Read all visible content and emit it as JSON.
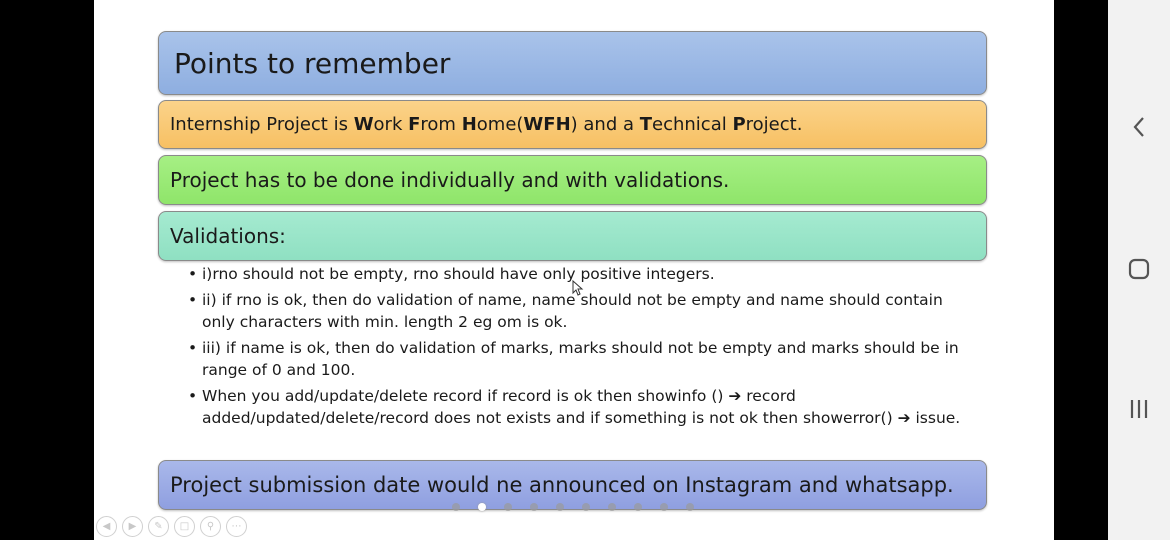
{
  "slide": {
    "title": "Points to remember",
    "wfh_line": {
      "parts": [
        {
          "t": "Internship Project is ",
          "b": false
        },
        {
          "t": "W",
          "b": true
        },
        {
          "t": "ork ",
          "b": false
        },
        {
          "t": "F",
          "b": true
        },
        {
          "t": "rom ",
          "b": false
        },
        {
          "t": "H",
          "b": true
        },
        {
          "t": "ome(",
          "b": false
        },
        {
          "t": "WFH",
          "b": true
        },
        {
          "t": ") and a ",
          "b": false
        },
        {
          "t": "T",
          "b": true
        },
        {
          "t": "echnical ",
          "b": false
        },
        {
          "t": "P",
          "b": true
        },
        {
          "t": "roject.",
          "b": false
        }
      ]
    },
    "individual_line": "Project has to be done individually and with validations.",
    "validations_header": "Validations:",
    "bullets": [
      "i)rno should not be empty, rno should have only positive integers.",
      "ii) if rno is ok, then do validation of name, name should not be empty and name should contain only characters with min. length 2 eg om is ok.",
      "iii) if name is ok, then do validation of marks, marks should not be empty and marks should be in range of 0 and 100.",
      "When you add/update/delete record if record is ok then showinfo () ➔ record added/updated/delete/record does not exists and if something is not ok then showerror() ➔ issue."
    ],
    "submission_line": "Project submission date would ne announced on Instagram and whatsapp."
  },
  "pagination": {
    "total": 10,
    "active_index": 1
  },
  "slide_controls": [
    "prev-icon",
    "next-icon",
    "pen-icon",
    "slides-icon",
    "zoom-icon",
    "more-icon"
  ],
  "android_nav": [
    "back-icon",
    "home-icon",
    "recents-icon"
  ],
  "colors": {
    "title_box": "#98b6e4",
    "wfh_box": "#f9c872",
    "individual_box": "#98e977",
    "validations_box": "#98e5c8",
    "submission_box": "#98a8e4"
  }
}
